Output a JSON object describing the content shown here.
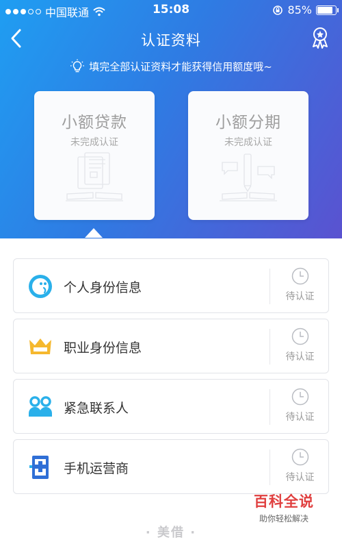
{
  "status_bar": {
    "carrier": "中国联通",
    "time": "15:08",
    "battery": "85%",
    "battery_level": 0.85
  },
  "nav": {
    "title": "认证资料"
  },
  "tip": "填完全部认证资料才能获得信用额度哦~",
  "cards": [
    {
      "title": "小额贷款",
      "subtitle": "未完成认证",
      "icon": "document-book-illustration"
    },
    {
      "title": "小额分期",
      "subtitle": "未完成认证",
      "icon": "pencil-chat-illustration"
    }
  ],
  "list": [
    {
      "label": "个人身份信息",
      "status": "待认证",
      "icon": "smiley-icon",
      "icon_color": "#2ab0ea"
    },
    {
      "label": "职业身份信息",
      "status": "待认证",
      "icon": "crown-icon",
      "icon_color": "#f5b82e"
    },
    {
      "label": "紧急联系人",
      "status": "待认证",
      "icon": "contacts-icon",
      "icon_color": "#2ab0ea"
    },
    {
      "label": "手机运营商",
      "status": "待认证",
      "icon": "operator-icon",
      "icon_color": "#2f6fd6"
    }
  ],
  "footer": {
    "brand": "· 美借 ·"
  },
  "watermark": {
    "title": "百科全说",
    "subtitle": "助你轻松解决"
  },
  "colors": {
    "gradient_start": "#1f9ef2",
    "gradient_end": "#5a52d0",
    "status_pending": "#9a9a9a"
  }
}
